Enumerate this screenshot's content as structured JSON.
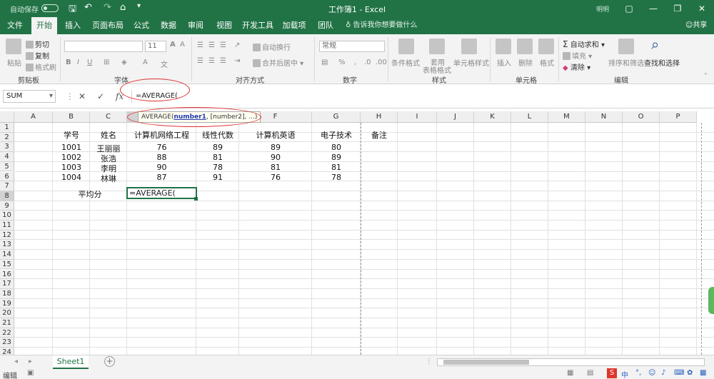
{
  "titlebar": {
    "autosave_label": "自动保存",
    "title": "工作簿1  -  Excel",
    "user": "明明",
    "min": "—",
    "restore": "❐",
    "max": "▢",
    "close": "✕"
  },
  "tabs": [
    {
      "label": "文件"
    },
    {
      "label": "开始"
    },
    {
      "label": "插入"
    },
    {
      "label": "页面布局"
    },
    {
      "label": "公式"
    },
    {
      "label": "数据"
    },
    {
      "label": "审阅"
    },
    {
      "label": "视图"
    },
    {
      "label": "开发工具"
    },
    {
      "label": "加载项"
    },
    {
      "label": "团队"
    }
  ],
  "tellme": "告诉我你想要做什么",
  "share": "共享",
  "ribbon": {
    "groups": [
      "剪贴板",
      "字体",
      "对齐方式",
      "数字",
      "样式",
      "单元格",
      "编辑"
    ],
    "clipboard": {
      "paste": "粘贴",
      "cut": "剪切",
      "copy": "复制",
      "format_painter": "格式刷"
    },
    "font": {
      "font_size": "11"
    },
    "alignment": {
      "wrap": "自动换行",
      "merge": "合并后居中"
    },
    "number": {
      "format": "常规"
    },
    "styles": {
      "conditional": "条件格式",
      "table": "套用",
      "table2": "表格格式",
      "cell_styles": "单元格样式"
    },
    "cells": {
      "insert": "插入",
      "delete": "删除",
      "format": "格式"
    },
    "editing": {
      "autosum": "自动求和",
      "fill": "填充",
      "clear": "清除",
      "sort": "排序和筛选",
      "find": "查找和选择"
    }
  },
  "formula_bar": {
    "name_box": "SUM",
    "cancel": "✕",
    "enter": "✓",
    "fx": "fx",
    "content": "=AVERAGE("
  },
  "tooltip": {
    "fn": "AVERAGE(",
    "arg1": "number1",
    "rest": ", [number2], ...)"
  },
  "columns": [
    "A",
    "B",
    "C",
    "D",
    "E",
    "F",
    "G",
    "H",
    "I",
    "J",
    "K",
    "L",
    "M",
    "N",
    "O",
    "P"
  ],
  "rows": [
    "1",
    "2",
    "3",
    "4",
    "5",
    "6",
    "7",
    "8",
    "9",
    "10",
    "11",
    "12",
    "13",
    "14",
    "15",
    "16",
    "17",
    "18",
    "19",
    "20",
    "21",
    "22",
    "23",
    "24"
  ],
  "table": {
    "headers": [
      "学号",
      "姓名",
      "计算机网络工程",
      "线性代数",
      "计算机英语",
      "电子技术",
      "备注"
    ],
    "records": [
      [
        "1001",
        "王丽丽",
        "76",
        "89",
        "89",
        "80"
      ],
      [
        "1002",
        "张浩",
        "88",
        "81",
        "90",
        "89"
      ],
      [
        "1003",
        "李明",
        "90",
        "78",
        "81",
        "81"
      ],
      [
        "1004",
        "林琳",
        "87",
        "91",
        "76",
        "78"
      ]
    ],
    "avg_label": "平均分",
    "active_cell_text": "=AVERAGE("
  },
  "sheets": [
    {
      "label": "Sheet1"
    }
  ],
  "add_sheet": "+",
  "status": {
    "mode": "编辑"
  }
}
